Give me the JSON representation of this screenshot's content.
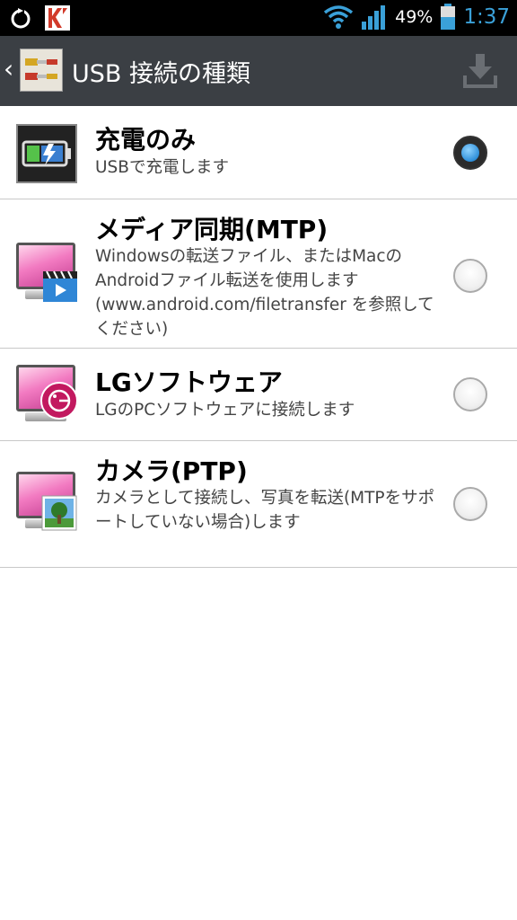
{
  "statusbar": {
    "battery_pct": "49%",
    "time": "1:37"
  },
  "actionbar": {
    "title": "USB 接続の種類"
  },
  "items": [
    {
      "title": "充電のみ",
      "subtitle": "USBで充電します",
      "checked": true
    },
    {
      "title": "メディア同期(MTP)",
      "subtitle": "Windowsの転送ファイル、またはMacのAndroidファイル転送を使用します(www.android.com/filetransfer を参照してください)",
      "checked": false
    },
    {
      "title": "LGソフトウェア",
      "subtitle": "LGのPCソフトウェアに接続します",
      "checked": false
    },
    {
      "title": "カメラ(PTP)",
      "subtitle": "カメラとして接続し、写真を転送(MTPをサポートしていない場合)します",
      "checked": false
    }
  ],
  "colors": {
    "statusbar_bg": "#000000",
    "actionbar_bg": "#3b3f44",
    "accent": "#3aa0d8",
    "divider": "#c8c8c8"
  }
}
